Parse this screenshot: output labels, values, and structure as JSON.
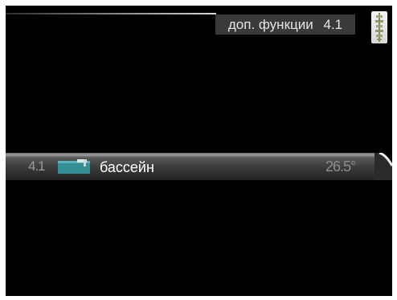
{
  "header": {
    "title": "доп. функции",
    "menu_number": "4.1"
  },
  "scroll_handle": {
    "icon": "scroll-handle-icon"
  },
  "menu": {
    "items": [
      {
        "number": "4.1",
        "icon": "pool-icon",
        "label": "бассейн",
        "value": "26.5°"
      }
    ]
  },
  "colors": {
    "background": "#000000",
    "header_bg": "#3a3a3a",
    "header_text": "#e4e4e4",
    "pool_icon": "#2f8f94",
    "row_label": "#ffffff",
    "row_dim_text": "#9a9a9a"
  }
}
